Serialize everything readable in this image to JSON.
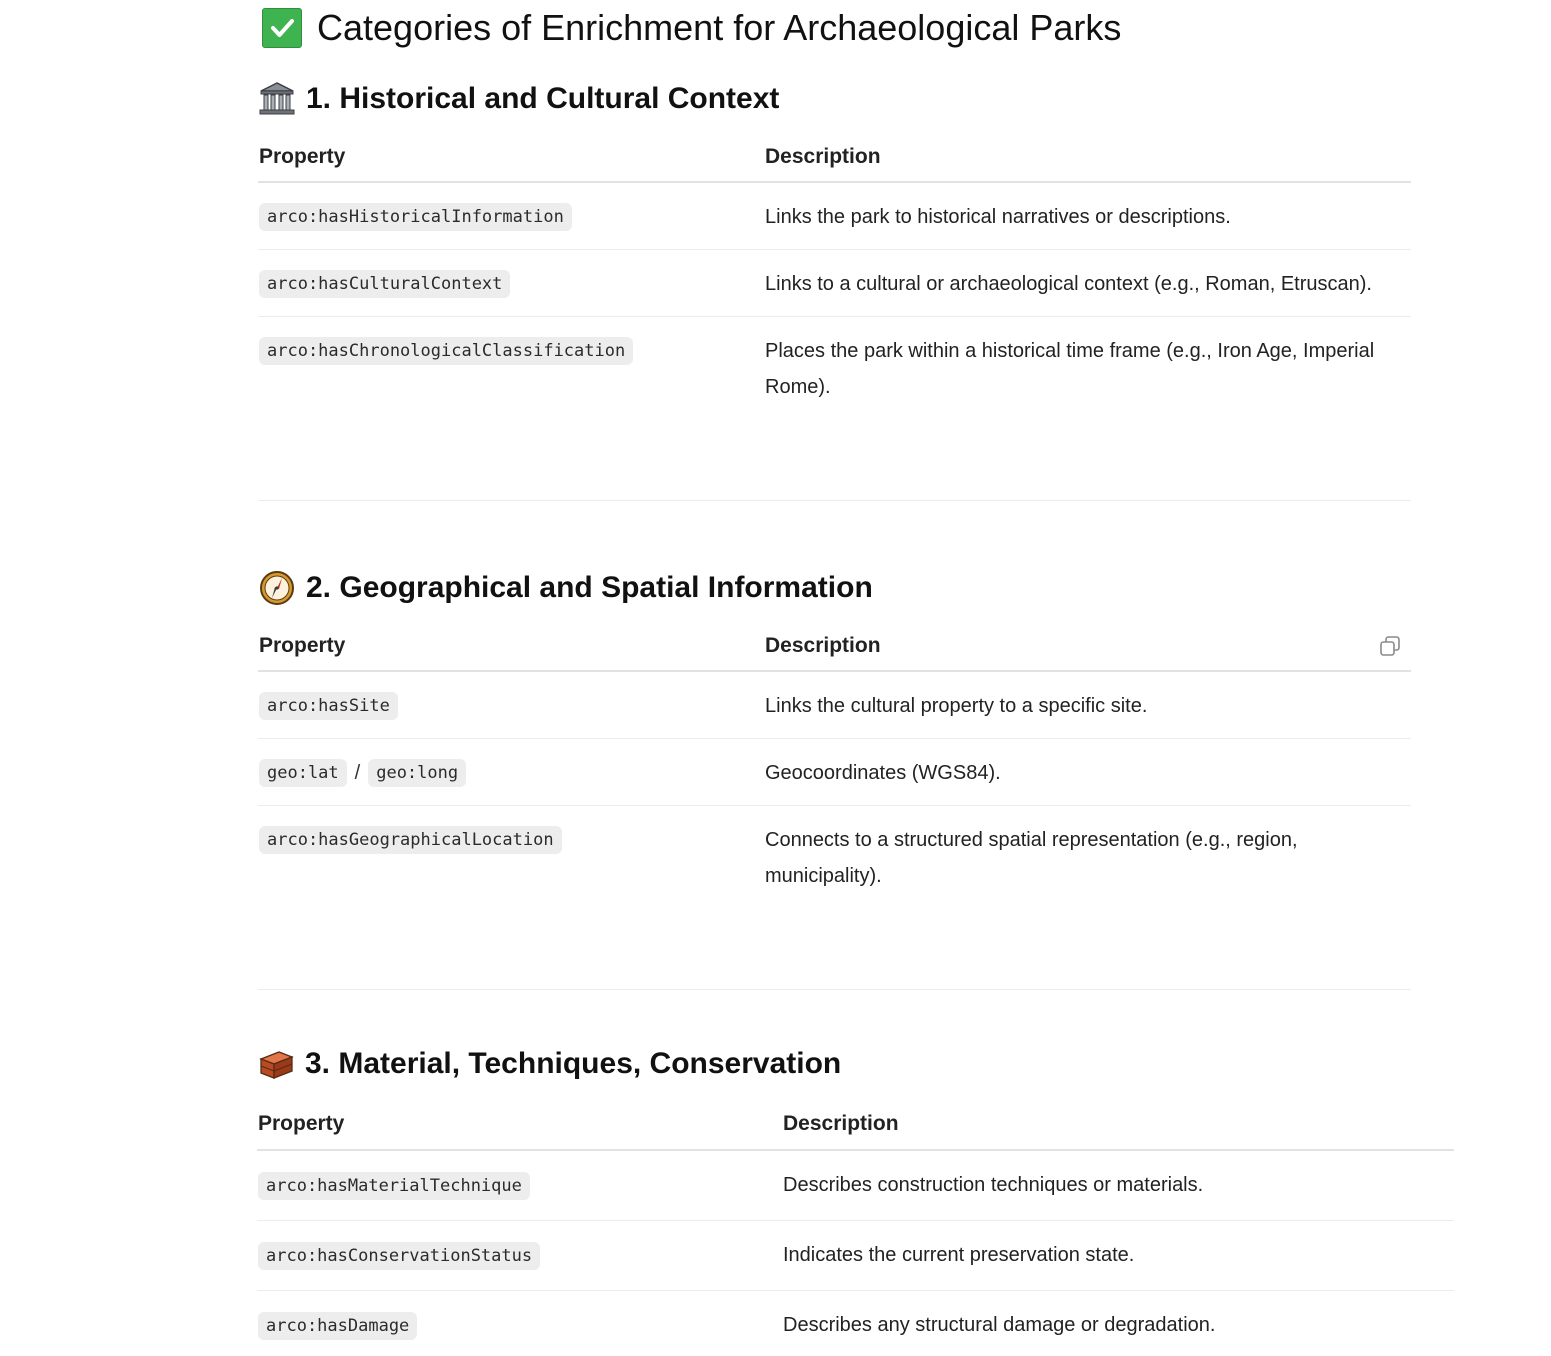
{
  "title": "Categories of Enrichment for Archaeological Parks",
  "colors": {
    "check_green": "#3fb34f",
    "code_bg": "#ededed",
    "rule": "#e2e2e2"
  },
  "sections": [
    {
      "icon": "classical-building-icon",
      "heading": "1. Historical and Cultural Context",
      "columns": [
        "Property",
        "Description"
      ],
      "rows": [
        {
          "property": "arco:hasHistoricalInformation",
          "description": "Links the park to historical narratives or descriptions."
        },
        {
          "property": "arco:hasCulturalContext",
          "description": "Links to a cultural or archaeological context (e.g., Roman, Etruscan)."
        },
        {
          "property": "arco:hasChronologicalClassification",
          "description": "Places the park within a historical time frame (e.g., Iron Age, Imperial Rome)."
        }
      ]
    },
    {
      "icon": "compass-icon",
      "heading": "2. Geographical and Spatial Information",
      "columns": [
        "Property",
        "Description"
      ],
      "rows": [
        {
          "property": "arco:hasSite",
          "description": "Links the cultural property to a specific site."
        },
        {
          "property": "geo:lat",
          "property2": "geo:long",
          "separator": "/",
          "description": "Geocoordinates (WGS84)."
        },
        {
          "property": "arco:hasGeographicalLocation",
          "description": "Connects to a structured spatial representation (e.g., region, municipality)."
        }
      ]
    },
    {
      "icon": "brick-icon",
      "heading": "3. Material, Techniques, Conservation",
      "columns": [
        "Property",
        "Description"
      ],
      "rows": [
        {
          "property": "arco:hasMaterialTechnique",
          "description": "Describes construction techniques or materials."
        },
        {
          "property": "arco:hasConservationStatus",
          "description": "Indicates the current preservation state."
        },
        {
          "property": "arco:hasDamage",
          "description": "Describes any structural damage or degradation."
        }
      ]
    }
  ]
}
